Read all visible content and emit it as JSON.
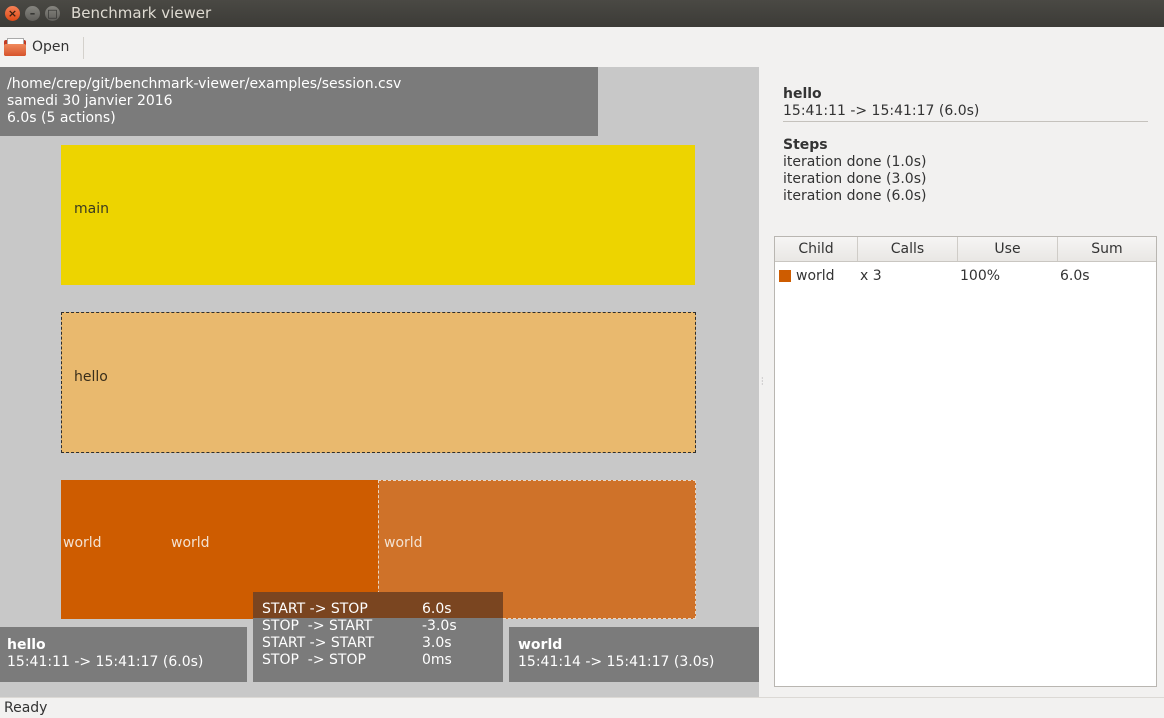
{
  "window": {
    "title": "Benchmark viewer",
    "buttons": {
      "close": "×",
      "minimize": "–",
      "maximize": "□"
    }
  },
  "toolbar": {
    "open_label": "Open",
    "open_icon": "folder-open-icon"
  },
  "session": {
    "path": "/home/crep/git/benchmark-viewer/examples/session.csv",
    "date": "samedi 30 janvier 2016",
    "summary": "6.0s (5 actions)"
  },
  "blocks": {
    "main": {
      "label": "main",
      "color": "#edd400"
    },
    "hello": {
      "label": "hello",
      "color": "#e9b96e"
    },
    "world1": {
      "label": "world",
      "color": "#ce5c00"
    },
    "world2": {
      "label": "world",
      "color": "#ce5c00"
    },
    "world3": {
      "label": "world",
      "color": "#cf7229"
    }
  },
  "bottom_info": {
    "left": {
      "name": "hello",
      "time": "15:41:11 -> 15:41:17 (6.0s)"
    },
    "right": {
      "name": "world",
      "time": "15:41:14 -> 15:41:17 (3.0s)"
    }
  },
  "tooltip": {
    "rows": [
      {
        "key": "START -> STOP",
        "value": "6.0s"
      },
      {
        "key": "STOP  -> START",
        "value": "-3.0s"
      },
      {
        "key": "START -> START",
        "value": "3.0s"
      },
      {
        "key": "STOP  -> STOP",
        "value": "0ms"
      }
    ]
  },
  "details": {
    "name": "hello",
    "time": "15:41:11 -> 15:41:17 (6.0s)",
    "steps_heading": "Steps",
    "steps": [
      "iteration done (1.0s)",
      "iteration done (3.0s)",
      "iteration done (6.0s)"
    ]
  },
  "children_table": {
    "headers": [
      "Child",
      "Calls",
      "Use",
      "Sum"
    ],
    "rows": [
      {
        "child": "world",
        "calls": "x 3",
        "use": "100%",
        "sum": "6.0s",
        "color": "#ce5c00"
      }
    ]
  },
  "status": "Ready"
}
